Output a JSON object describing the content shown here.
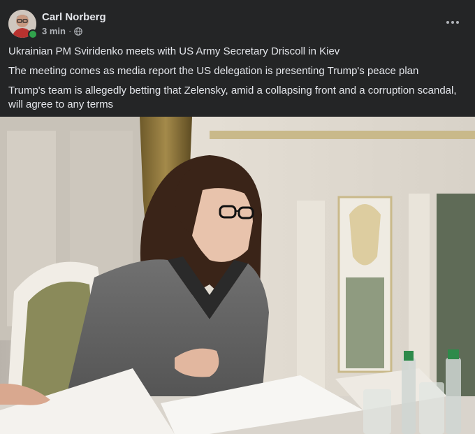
{
  "post": {
    "author": "Carl Norberg",
    "time": "3 min",
    "separator": "·",
    "privacy_icon": "globe-icon",
    "more_icon": "more-horizontal-icon",
    "lines": [
      "Ukrainian PM Sviridenko meets with US Army Secretary Driscoll in Kiev",
      "The meeting comes as media report the US delegation is presenting Trump's peace plan",
      "Trump's team is allegedly betting that Zelensky, amid a collapsing front and a corruption scandal, will agree to any terms"
    ]
  },
  "colors": {
    "background": "#242526",
    "text_primary": "#e4e6eb",
    "text_secondary": "#b0b3b8",
    "online": "#31a24c"
  }
}
